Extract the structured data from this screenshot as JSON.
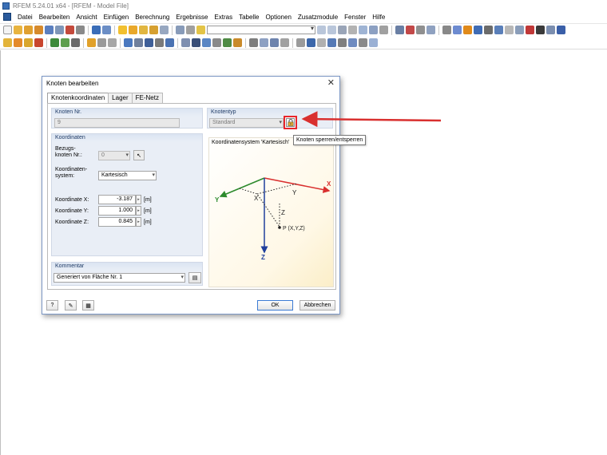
{
  "window": {
    "title": "RFEM 5.24.01 x64 - [RFEM - Model File]"
  },
  "menu": [
    "Datei",
    "Bearbeiten",
    "Ansicht",
    "Einfügen",
    "Berechnung",
    "Ergebnisse",
    "Extras",
    "Tabelle",
    "Optionen",
    "Zusatzmodule",
    "Fenster",
    "Hilfe"
  ],
  "colors": {
    "red_arrow": "#d9302f",
    "lock_highlight": "#e8262c",
    "x_axis": "#d9302f",
    "y_axis": "#2c8a2c",
    "z_axis": "#1f3f9c"
  },
  "dialog": {
    "title": "Knoten bearbeiten",
    "tabs": [
      "Knotenkoordinaten",
      "Lager",
      "FE-Netz"
    ],
    "knoten_nr": {
      "header": "Knoten Nr.",
      "value": "9"
    },
    "knotentyp": {
      "header": "Knotentyp",
      "value": "Standard",
      "lock_icon": "lock-icon"
    },
    "tooltip": "Knoten sperren/entsperren",
    "koordinaten": {
      "header": "Koordinaten",
      "bezugsknoten_label_1": "Bezugs-",
      "bezugsknoten_label_2": "knoten Nr.:",
      "bezugsknoten_value": "0",
      "system_label_1": "Koordinaten-",
      "system_label_2": "system:",
      "system_value": "Kartesisch",
      "rows": [
        {
          "label": "Koordinate X:",
          "value": "-3.187",
          "unit": "[m]"
        },
        {
          "label": "Koordinate Y:",
          "value": "1.000",
          "unit": "[m]"
        },
        {
          "label": "Koordinate Z:",
          "value": "0.845",
          "unit": "[m]"
        }
      ]
    },
    "diagram": {
      "title": "Koordinatensystem 'Kartesisch'",
      "x": "X",
      "y": "Y",
      "z": "Z",
      "point": "P (X,Y,Z)"
    },
    "kommentar": {
      "header": "Kommentar",
      "value": "Generiert von Fläche Nr. 1"
    },
    "buttons": {
      "ok": "OK",
      "cancel": "Abbrechen"
    },
    "footer_icons": [
      "help-icon",
      "edit-icon",
      "units-icon"
    ]
  }
}
